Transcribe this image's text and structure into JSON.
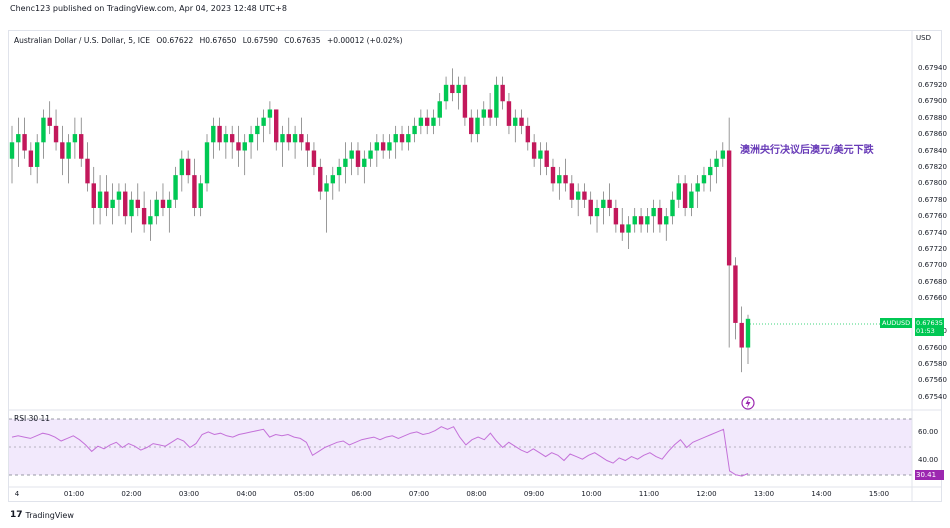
{
  "caption": "Chenc123 published on TradingView.com, Apr 04, 2023 12:48 UTC+8",
  "legend": {
    "symbol": "Australian Dollar / U.S. Dollar, 5, ICE",
    "open": "O0.67622",
    "high": "H0.67650",
    "low": "L0.67590",
    "close": "C0.67635",
    "change": "+0.00012 (+0.02%)"
  },
  "currency": "USD",
  "price_ticks": [
    "0.67940",
    "0.67920",
    "0.67900",
    "0.67880",
    "0.67860",
    "0.67840",
    "0.67820",
    "0.67800",
    "0.67780",
    "0.67760",
    "0.67740",
    "0.67720",
    "0.67700",
    "0.67680",
    "0.67660",
    "0.67620",
    "0.67600",
    "0.67580",
    "0.67560",
    "0.67540"
  ],
  "time_ticks": [
    "4",
    "01:00",
    "02:00",
    "03:00",
    "04:00",
    "05:00",
    "06:00",
    "07:00",
    "08:00",
    "09:00",
    "10:00",
    "11:00",
    "12:00",
    "13:00",
    "14:00",
    "15:00"
  ],
  "annotation": "澳洲央行决议后澳元/美元下跌",
  "ticker_badge": "AUDUSD",
  "price_badge": {
    "price": "0.67635",
    "countdown": "01:53"
  },
  "rsi": {
    "label": "RSI 30 11",
    "levels": [
      "60.00",
      "40.00"
    ],
    "value": "30.41"
  },
  "footer": {
    "logo": "17",
    "name": "TradingView"
  },
  "colors": {
    "up": "#26a69a",
    "up_bright": "#00c853",
    "down": "#c2185b",
    "rsi_line": "#c471d9",
    "rsi_fill": "#efe3fb",
    "annotation": "#673ab7"
  },
  "icons": {
    "event_icon": "lightning-circle-icon"
  },
  "chart_data": {
    "type": "candlestick",
    "price_range": [
      0.6753,
      0.6796
    ],
    "rsi_range": [
      25,
      75
    ],
    "candles": [
      [
        0.6783,
        0.6787,
        0.678,
        0.6785
      ],
      [
        0.6785,
        0.6788,
        0.6782,
        0.6786
      ],
      [
        0.6786,
        0.6788,
        0.6783,
        0.6784
      ],
      [
        0.6784,
        0.6785,
        0.6781,
        0.6782
      ],
      [
        0.6782,
        0.6786,
        0.678,
        0.6785
      ],
      [
        0.6785,
        0.6789,
        0.6783,
        0.6788
      ],
      [
        0.6788,
        0.679,
        0.6786,
        0.6787
      ],
      [
        0.6787,
        0.6789,
        0.6784,
        0.6785
      ],
      [
        0.6785,
        0.6787,
        0.6781,
        0.6783
      ],
      [
        0.6783,
        0.6786,
        0.678,
        0.6785
      ],
      [
        0.6785,
        0.6788,
        0.6783,
        0.6786
      ],
      [
        0.6786,
        0.6788,
        0.6782,
        0.6783
      ],
      [
        0.6783,
        0.6785,
        0.6779,
        0.678
      ],
      [
        0.678,
        0.6782,
        0.6775,
        0.6777
      ],
      [
        0.6777,
        0.6781,
        0.6775,
        0.6779
      ],
      [
        0.6779,
        0.6781,
        0.6776,
        0.6777
      ],
      [
        0.6777,
        0.678,
        0.6775,
        0.6778
      ],
      [
        0.6778,
        0.678,
        0.6776,
        0.6779
      ],
      [
        0.6779,
        0.678,
        0.6775,
        0.6776
      ],
      [
        0.6776,
        0.6779,
        0.6774,
        0.6778
      ],
      [
        0.6778,
        0.678,
        0.6776,
        0.6777
      ],
      [
        0.6777,
        0.6779,
        0.6774,
        0.6775
      ],
      [
        0.6775,
        0.6778,
        0.6773,
        0.6776
      ],
      [
        0.6776,
        0.6779,
        0.6775,
        0.6778
      ],
      [
        0.6778,
        0.678,
        0.6776,
        0.6777
      ],
      [
        0.6777,
        0.6779,
        0.6774,
        0.6778
      ],
      [
        0.6778,
        0.6782,
        0.6777,
        0.6781
      ],
      [
        0.6781,
        0.6784,
        0.6779,
        0.6783
      ],
      [
        0.6783,
        0.6784,
        0.678,
        0.6781
      ],
      [
        0.6781,
        0.6783,
        0.6776,
        0.6777
      ],
      [
        0.6777,
        0.6781,
        0.6776,
        0.678
      ],
      [
        0.678,
        0.6786,
        0.6779,
        0.6785
      ],
      [
        0.6785,
        0.6788,
        0.6783,
        0.6787
      ],
      [
        0.6787,
        0.6788,
        0.6784,
        0.6785
      ],
      [
        0.6785,
        0.6787,
        0.6783,
        0.6786
      ],
      [
        0.6786,
        0.6787,
        0.6783,
        0.6785
      ],
      [
        0.6785,
        0.6787,
        0.6782,
        0.6784
      ],
      [
        0.6784,
        0.6786,
        0.6781,
        0.6785
      ],
      [
        0.6785,
        0.6787,
        0.6783,
        0.6786
      ],
      [
        0.6786,
        0.6788,
        0.6784,
        0.6787
      ],
      [
        0.6787,
        0.6789,
        0.6785,
        0.6788
      ],
      [
        0.6788,
        0.679,
        0.6786,
        0.6789
      ],
      [
        0.6789,
        0.6789,
        0.6784,
        0.6785
      ],
      [
        0.6785,
        0.6787,
        0.6782,
        0.6786
      ],
      [
        0.6786,
        0.6788,
        0.6784,
        0.6785
      ],
      [
        0.6785,
        0.6787,
        0.6783,
        0.6786
      ],
      [
        0.6786,
        0.6788,
        0.6784,
        0.6785
      ],
      [
        0.6785,
        0.6786,
        0.6782,
        0.6784
      ],
      [
        0.6784,
        0.6785,
        0.6781,
        0.6782
      ],
      [
        0.6782,
        0.6783,
        0.6778,
        0.6779
      ],
      [
        0.6779,
        0.6781,
        0.6774,
        0.678
      ],
      [
        0.678,
        0.6782,
        0.6778,
        0.6781
      ],
      [
        0.6781,
        0.6783,
        0.6779,
        0.6782
      ],
      [
        0.6782,
        0.6785,
        0.678,
        0.6783
      ],
      [
        0.6783,
        0.6785,
        0.6781,
        0.6784
      ],
      [
        0.6784,
        0.6785,
        0.6781,
        0.6782
      ],
      [
        0.6782,
        0.6784,
        0.678,
        0.6783
      ],
      [
        0.6783,
        0.6785,
        0.6782,
        0.6784
      ],
      [
        0.6784,
        0.6786,
        0.6782,
        0.6785
      ],
      [
        0.6785,
        0.6786,
        0.6783,
        0.6784
      ],
      [
        0.6784,
        0.6786,
        0.6783,
        0.6785
      ],
      [
        0.6785,
        0.6787,
        0.6783,
        0.6786
      ],
      [
        0.6786,
        0.6787,
        0.6784,
        0.6785
      ],
      [
        0.6785,
        0.6787,
        0.6784,
        0.6786
      ],
      [
        0.6786,
        0.6788,
        0.6785,
        0.6787
      ],
      [
        0.6787,
        0.6789,
        0.6786,
        0.6788
      ],
      [
        0.6788,
        0.6789,
        0.6786,
        0.6787
      ],
      [
        0.6787,
        0.6789,
        0.6786,
        0.6788
      ],
      [
        0.6788,
        0.6791,
        0.6787,
        0.679
      ],
      [
        0.679,
        0.6793,
        0.6789,
        0.6792
      ],
      [
        0.6792,
        0.6794,
        0.679,
        0.6791
      ],
      [
        0.6791,
        0.6793,
        0.6789,
        0.6792
      ],
      [
        0.6792,
        0.6793,
        0.6787,
        0.6788
      ],
      [
        0.6788,
        0.6789,
        0.6785,
        0.6786
      ],
      [
        0.6786,
        0.6789,
        0.6785,
        0.6788
      ],
      [
        0.6788,
        0.679,
        0.6787,
        0.6789
      ],
      [
        0.6789,
        0.6791,
        0.6787,
        0.6788
      ],
      [
        0.6788,
        0.6793,
        0.6787,
        0.6792
      ],
      [
        0.6792,
        0.6793,
        0.6789,
        0.679
      ],
      [
        0.679,
        0.6791,
        0.6786,
        0.6787
      ],
      [
        0.6787,
        0.6789,
        0.6785,
        0.6788
      ],
      [
        0.6788,
        0.6789,
        0.6786,
        0.6787
      ],
      [
        0.6787,
        0.6788,
        0.6784,
        0.6785
      ],
      [
        0.6785,
        0.6786,
        0.6782,
        0.6783
      ],
      [
        0.6783,
        0.6785,
        0.6781,
        0.6784
      ],
      [
        0.6784,
        0.6785,
        0.6781,
        0.6782
      ],
      [
        0.6782,
        0.6783,
        0.6779,
        0.678
      ],
      [
        0.678,
        0.6782,
        0.6778,
        0.6781
      ],
      [
        0.6781,
        0.6783,
        0.6779,
        0.678
      ],
      [
        0.678,
        0.6781,
        0.6777,
        0.6778
      ],
      [
        0.6778,
        0.678,
        0.6776,
        0.6779
      ],
      [
        0.6779,
        0.678,
        0.6777,
        0.6778
      ],
      [
        0.6778,
        0.6779,
        0.6775,
        0.6776
      ],
      [
        0.6776,
        0.6778,
        0.6774,
        0.6777
      ],
      [
        0.6777,
        0.6779,
        0.6775,
        0.6778
      ],
      [
        0.6778,
        0.678,
        0.6776,
        0.6777
      ],
      [
        0.6777,
        0.6778,
        0.6774,
        0.6775
      ],
      [
        0.6775,
        0.6777,
        0.6773,
        0.6774
      ],
      [
        0.6774,
        0.6776,
        0.6772,
        0.6775
      ],
      [
        0.6775,
        0.6777,
        0.6774,
        0.6776
      ],
      [
        0.6776,
        0.6777,
        0.6774,
        0.6775
      ],
      [
        0.6775,
        0.6777,
        0.6774,
        0.6776
      ],
      [
        0.6776,
        0.6778,
        0.6774,
        0.6777
      ],
      [
        0.6777,
        0.6778,
        0.6774,
        0.6775
      ],
      [
        0.6775,
        0.6777,
        0.6773,
        0.6776
      ],
      [
        0.6776,
        0.6779,
        0.6775,
        0.6778
      ],
      [
        0.6778,
        0.6781,
        0.6777,
        0.678
      ],
      [
        0.678,
        0.6781,
        0.6776,
        0.6777
      ],
      [
        0.6777,
        0.678,
        0.6776,
        0.6779
      ],
      [
        0.6779,
        0.6781,
        0.6777,
        0.678
      ],
      [
        0.678,
        0.6782,
        0.6779,
        0.6781
      ],
      [
        0.6781,
        0.6783,
        0.6779,
        0.6782
      ],
      [
        0.6782,
        0.6784,
        0.678,
        0.6783
      ],
      [
        0.6783,
        0.6785,
        0.6782,
        0.6784
      ],
      [
        0.6784,
        0.6788,
        0.676,
        0.677
      ],
      [
        0.677,
        0.6771,
        0.6761,
        0.6763
      ],
      [
        0.6763,
        0.6765,
        0.6757,
        0.676
      ],
      [
        0.676,
        0.6764,
        0.6758,
        0.67635
      ]
    ],
    "rsi_values": [
      58,
      59,
      58,
      57,
      59,
      61,
      60,
      58,
      55,
      57,
      59,
      56,
      52,
      47,
      51,
      49,
      52,
      54,
      50,
      53,
      51,
      48,
      50,
      53,
      52,
      51,
      54,
      57,
      55,
      50,
      53,
      60,
      62,
      60,
      61,
      59,
      58,
      60,
      61,
      62,
      63,
      64,
      58,
      60,
      59,
      60,
      58,
      57,
      54,
      44,
      47,
      50,
      52,
      54,
      55,
      52,
      54,
      56,
      57,
      58,
      56,
      58,
      59,
      57,
      59,
      61,
      62,
      60,
      61,
      63,
      66,
      64,
      66,
      58,
      52,
      56,
      58,
      56,
      61,
      55,
      50,
      54,
      51,
      48,
      46,
      49,
      46,
      43,
      46,
      44,
      40,
      45,
      43,
      41,
      44,
      46,
      43,
      40,
      38,
      42,
      40,
      43,
      41,
      44,
      46,
      43,
      41,
      47,
      52,
      56,
      50,
      54,
      56,
      58,
      60,
      62,
      64,
      32,
      29,
      28,
      30
    ]
  }
}
